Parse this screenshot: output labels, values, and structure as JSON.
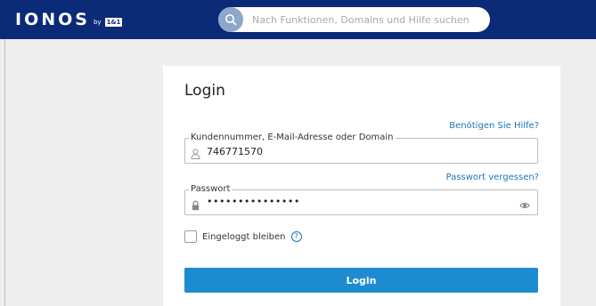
{
  "header": {
    "brand": "IONOS",
    "brand_by": "by",
    "brand_badge": "1&1",
    "colors": {
      "header_bg": "#0b2a78",
      "accent": "#1d8bd0",
      "link": "#1b75bb"
    },
    "search": {
      "icon": "search-icon",
      "placeholder": "Nach Funktionen, Domains und Hilfe suchen"
    }
  },
  "login": {
    "title": "Login",
    "help_link": "Benötigen Sie Hilfe?",
    "customer_field": {
      "label": "Kundennummer, E-Mail-Adresse oder Domain",
      "icon": "user-icon",
      "value": "746771570"
    },
    "forgot_password_link": "Passwort vergessen?",
    "password_field": {
      "label": "Passwort",
      "icon": "lock-icon",
      "value": "•••••••••••••••",
      "toggle_icon": "eye-icon"
    },
    "remember_me": {
      "label": "Eingeloggt bleiben",
      "checked": false,
      "help_icon": "help-circle-icon",
      "help_symbol": "?"
    },
    "submit_label": "Login"
  }
}
